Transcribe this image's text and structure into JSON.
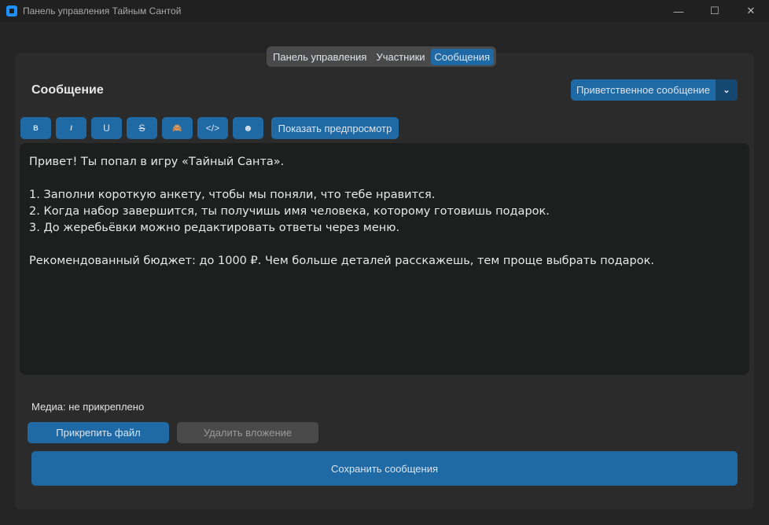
{
  "window": {
    "title": "Панель управления Тайным Сантой",
    "minimize": "—",
    "maximize": "☐",
    "close": "✕"
  },
  "tabs": [
    {
      "label": "Панель управления"
    },
    {
      "label": "Участники"
    },
    {
      "label": "Сообщения",
      "active": true
    }
  ],
  "heading": "Сообщение",
  "message_type": {
    "selected": "Приветственное сообщение",
    "arrow": "⌄"
  },
  "toolbar": {
    "bold": "B",
    "italic": "I",
    "underline": "U",
    "strike": "S",
    "spoiler": "🙈",
    "code": "</>",
    "emoji": "☻",
    "preview": "Показать предпросмотр"
  },
  "editor": {
    "text": "Привет! Ты попал в игру «Тайный Санта».\n\n1. Заполни короткую анкету, чтобы мы поняли, что тебе нравится.\n2. Когда набор завершится, ты получишь имя человека, которому готовишь подарок.\n3. До жеребьёвки можно редактировать ответы через меню.\n\nРекомендованный бюджет: до 1000 ₽. Чем больше деталей расскажешь, тем проще выбрать подарок."
  },
  "media": {
    "status": "Медиа: не прикреплено",
    "attach": "Прикрепить файл",
    "remove": "Удалить вложение"
  },
  "save": "Сохранить сообщения",
  "colors": {
    "accent": "#1f6aa5",
    "accent_dark": "#144870",
    "disabled": "#4a4a4a"
  }
}
